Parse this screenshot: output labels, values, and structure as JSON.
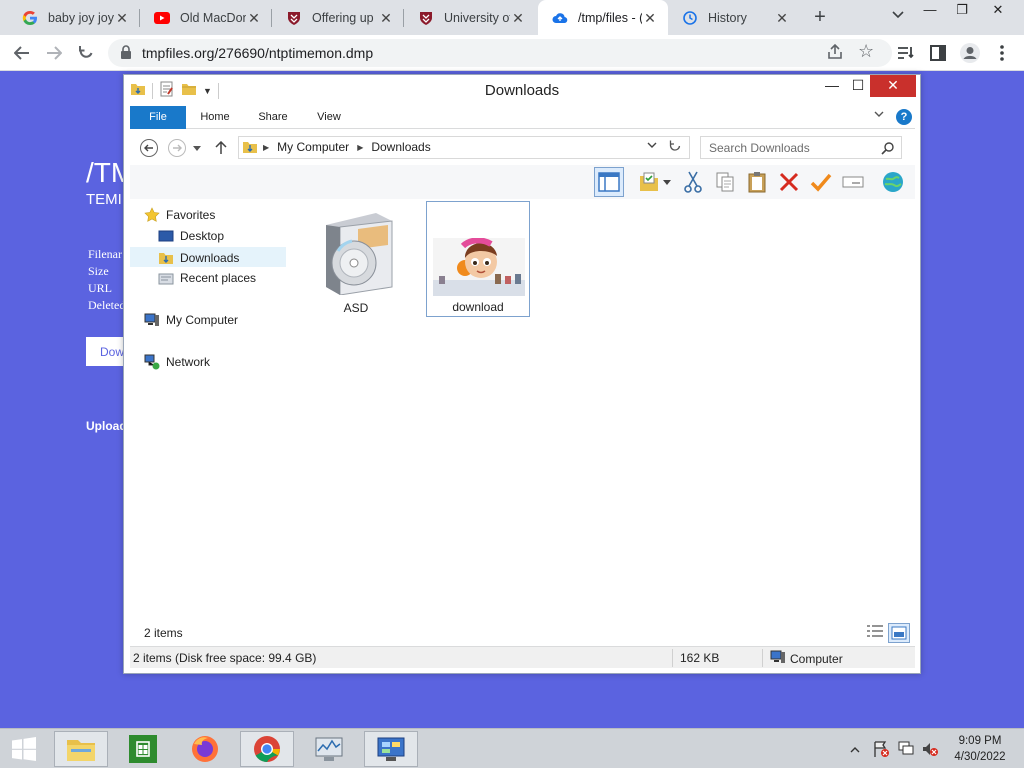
{
  "browser": {
    "tabs": [
      {
        "title": "baby joy joy",
        "icon": "google-g-icon"
      },
      {
        "title": "Old MacDon",
        "icon": "youtube-icon"
      },
      {
        "title": "Offering up",
        "icon": "uni-crest-icon"
      },
      {
        "title": "University of",
        "icon": "uni-crest-icon"
      },
      {
        "title": "/tmp/files - (",
        "icon": "cloud-upload-icon",
        "active": true
      },
      {
        "title": "History",
        "icon": "history-icon"
      }
    ],
    "url": "tmpfiles.org/276690/ntptimemon.dmp"
  },
  "webpage": {
    "title": "/TM",
    "subtitle": "TEMI",
    "lines": [
      "Filenar",
      "Size",
      "URL",
      "Deleted"
    ],
    "button": "Dow",
    "upload": "Upload"
  },
  "explorer": {
    "title": "Downloads",
    "ribbon_tabs": [
      "File",
      "Home",
      "Share",
      "View"
    ],
    "breadcrumb": [
      "My Computer",
      "Downloads"
    ],
    "search_placeholder": "Search Downloads",
    "nav": {
      "favorites": "Favorites",
      "desktop": "Desktop",
      "downloads": "Downloads",
      "recent": "Recent places",
      "computer": "My Computer",
      "network": "Network"
    },
    "items": [
      {
        "name": "ASD",
        "icon": "software-box-icon"
      },
      {
        "name": "download",
        "icon": "cartoon-thumbnail-icon",
        "selected": true
      }
    ],
    "item_count": "2 items",
    "status": {
      "left": "2 items (Disk free space: 99.4 GB)",
      "size": "162 KB",
      "location": "Computer"
    }
  },
  "taskbar": {
    "time": "9:09 PM",
    "date": "4/30/2022"
  },
  "colors": {
    "page_bg": "#5b63e0",
    "file_tab": "#1979ca",
    "close": "#c9302c"
  }
}
